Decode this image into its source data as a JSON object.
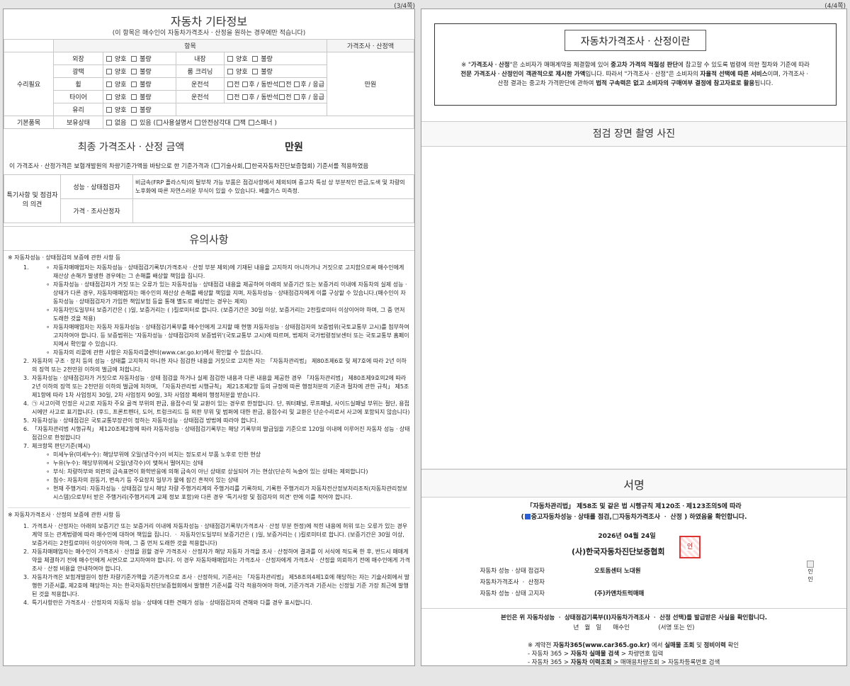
{
  "page_left": {
    "num": "(3/4쪽)"
  },
  "page_right": {
    "num": "(4/4쪽)"
  },
  "misc": {
    "title": "자동차 기타정보",
    "subtitle": "(이 항목은 매수인이 자동차가격조사ㆍ산정을 원하는 경우에만 적습니다)",
    "col_item": "항목",
    "col_price": "가격조사ㆍ산정액",
    "repair_label": "수리필요",
    "basic_label": "기본품목",
    "unit": "만원",
    "good": "양호",
    "bad": "불량",
    "rows": [
      {
        "a": "외장",
        "b": "내장"
      },
      {
        "a": "광택",
        "b": "룸 크리닝"
      },
      {
        "a": "휠",
        "b": "운전석"
      },
      {
        "a": "타이어",
        "b": "운전석"
      },
      {
        "a": "유리",
        "b": ""
      }
    ],
    "front": "전",
    "rear": "후",
    "passenger": "/ 동반석",
    "emergency": "/ 응급",
    "possess_label": "보유상태",
    "none": "없음",
    "yes": "있음 (",
    "manual": "사용설명서",
    "triangle": "안전삼각대",
    "jack": "잭",
    "spanner": "스패너 )"
  },
  "final": {
    "label": "최종 가격조사ㆍ산정 금액",
    "amount": "만원",
    "note_pre": "이 가격조사ㆍ산정가격은 보험개발원의 차량기준가액을 바탕으로 한 기준가격과 (",
    "opt1": "기술사회,",
    "opt2": "한국자동차진단보증협회) 기준서를 적용하였음"
  },
  "special": {
    "label": "특기사항 및 점검자의 의견",
    "r1": "성능ㆍ상태점검자",
    "r1_text": "비금속(FRP 플라스틱)의 탈부착 가능 부품은 점검사항에서 제외되며 중고차 특성 상 부분적인 판금,도색 및 차량의 노후화에 따른 자연스러운 부식이 있을 수 있습니다. 배출가스 미측정.",
    "r2": "가격ㆍ조사산정자"
  },
  "notice": {
    "title": "유의사항",
    "h1": "※ 자동차성능ㆍ상태점검의 보증에 관한 사항 등",
    "item1_no": "1.",
    "sub": [
      "자동차매매업자는 자동차성능ㆍ상태점검기록부(가격조사ㆍ산정 부분 제외)에 기재된 내용을 고지하지 아니하거나 거짓으로 고지함으로써 매수인에게 재산상 손해가 발생한 경우에는 그 손해를 배상할 책임을 집니다.",
      "자동차성능ㆍ상태점검자가 거짓 또는 오류가 있는 자동차성능ㆍ상태점검 내용을 제공하여 아래의 보증기간 또는 보증거리 이내에 자동차의 실제 성능ㆍ상태가 다른 경우, 자동차매매업자는 매수인의 재산상 손해를 배상할 책임을 지며, 자동차성능ㆍ상태점검자에게 이를 구상할 수 있습니다.(매수인이 자동차성능ㆍ상태점검자가 가입한 책임보험 등을 통해 별도로 배상받는 경우는 제외)",
      "자동차인도일부터 보증기간은 ( )일, 보증거리는 ( )킬로미터로 합니다. (보증기간은 30일 이상, 보증거리는 2천킬로미터 이상이어야 하며, 그 중 먼저 도래한 것을 적용)",
      "자동차매매업자는 자동차 자동차성능ㆍ상태점검기록부를 매수인에게 고지할 때 현행 자동차성능ㆍ상태점검자의 보증범위(국토교통부 고시)를 첨부하여 고지하여야 합니다. 등 보증범위는 '자동차성능ㆍ상태점검자의 보증범위'(국토교통부 고시)에 따르며, 법제처 국가법령정보센터 또는 국토교통부 홈페이지에서 확인할 수 있습니다.",
      "자동차의 리콜에 관한 사항은 자동차리콜센터(www.car.go.kr)에서 확인할 수 있습니다."
    ],
    "items": [
      {
        "n": "2.",
        "t": "자동차의 구조ㆍ장치 등의 성능ㆍ상태를 고지하지 아니한 자나 점검한 내용을 거짓으로 고지한 자는 「자동차관리법」 제80조제6호 및 제7호에 따라 2년 이하의 징역 또는 2천만원 이하의 벌금에 처합니다."
      },
      {
        "n": "3.",
        "t": "자동차성능ㆍ상태점검자가 거짓으로 자동차성능ㆍ상태 점검을 하거나 실제 점검한 내용과 다른 내용을 제공한 경우 「자동차관리법」 제80조제9호의2에 따라 2년 이하의 징역 또는 2천만원 이하의 벌금에 처하며, 「자동차관리법 시행규칙」 제21조제2항 등의 규정에 따른 행정처분의 기준과 절차에 관한 규칙」 제5조제1항에 따라 1차 사업정지 30일, 2차 사업정지 90일, 3차 사업장 폐쇄의 행정처분을 받습니다."
      },
      {
        "n": "4.",
        "t": "㉠ 사고이력 인정은 사고로 자동차 주요 골격 부위의 판금, 용접수리 및 교환이 있는 경우로 한정합니다. 단, 쿼터패널, 루프패널, 사이드실패널 부위는 절단, 용접 시에만 사고로 표기합니다. (후드, 프론트펜더, 도어, 트렁크리드 등 외판 부위 및 범퍼에 대한 판금, 용접수리 및 교환은 단순수리로서 사고에 포함되지 않습니다)"
      },
      {
        "n": "5.",
        "t": "자동차성능ㆍ상태점검은 국토교통부장관이 정하는 자동차성능ㆍ상태점검 방법에 따라야 합니다."
      },
      {
        "n": "6.",
        "t": "「자동차관리법 시행규칙」 제120조제2항에 따라 자동차성능ㆍ상태점검기록부는 해당 기록부의 발급일을 기준으로 120일 이내에 이루어진 자동차 성능ㆍ상태점검으로 한정합니다"
      },
      {
        "n": "7.",
        "t": "체크항목 판단기준(예시)"
      }
    ],
    "sub7": [
      "미세누유(미세누수): 해당부위에 오일(냉각수)이 비치는 정도로서 부품 노후로 인한 현상",
      "누유(누수): 해당부위에서 오일(냉각수)이 맺혀서 떨어지는 상태",
      "부식: 차량하부와 외판의 금속표면이 화학반응에 의해 금속이 아닌 상태로 상실되어 가는 현상(단순히 녹슬어 있는 상태는 제외합니다)",
      "침수: 자동차의 원동기, 변속기 등 주요장치 일부가 물에 잠긴 흔적이 있는 상태",
      "현재 주행거리: 자동차성능ㆍ상태점검 당시 해당 차량 주행거리계의 주행거리를 기록하되, 기록한 주행거리가 자동차전산정보처리조직(자동차관리정보시스템)으로부터 받은 주행거리(주행거리계 교체 정보 포함)와 다른 경우 '특기사항 및 점검자의 의견' 란에 이를 적어야 합니다."
    ],
    "h2": "※ 자동차가격조사ㆍ산정의 보증에 관한 사항 등",
    "items2": [
      {
        "n": "1.",
        "t": "가격조사ㆍ산정자는 아래의 보증기간 또는 보증거리 이내에 자동차성능ㆍ상태점검기록부(가격조사ㆍ산정 부분 한정)에 적힌 내용에 허위 또는 오류가 있는 경우 계약 또는 관계법령에 따라 매수인에 대하여 책임을 집니다. ㆍ 자동차인도일부터 보증기간은 ( )일, 보증거리는 ( )킬로미터로 합니다. (보증기간은 30일 이상, 보증거리는 2천킬로미터 이상이어야 하며, 그 중 먼저 도래한 것을 적용합니다)"
      },
      {
        "n": "2.",
        "t": "자동차매매업자는 매수인이 가격조사ㆍ산정을 원할 경우 가격조사ㆍ산정자가 해당 자동차 가격을 조사ㆍ산정하여 결과를 이 서식에 적도록 한 후, 반드시 매매계약을 체결하기 전에 매수인에게 서면으로 고지하여야 합니다. 이 경우 자동차매매업자는 가격조사ㆍ산정자에게 가격조사ㆍ산정을 의뢰하기 전에 매수인에게 가격조사ㆍ산정 비용을 안내하여야 합니다."
      },
      {
        "n": "3.",
        "t": "자동차가격은 보험개발원이 정한 차량기준가액을 기준가격으로 조사ㆍ산정하되, 기준서는 「자동차관리법」 제58조의4제1호에 해당하는 자는 기술사회에서 발행한 기준서를, 제2호에 해당하는 자는 한국자동차진단보증협회에서 발행한 기준서를 각각 적용하여야 하며, 기준가격과 기준서는 신정일 기준 가장 최근에 발행된 것을 적용합니다."
      },
      {
        "n": "4.",
        "t": "특기사항란은 가격조사ㆍ산정자의 자동차 성능ㆍ상태에 대한 견해가 성능ㆍ상태점검자의 견해와 다를 경우 표시합니다."
      }
    ]
  },
  "right": {
    "def_title": "자동차가격조사ㆍ산정이란",
    "def_a": "※ \"",
    "def_b": "가격조사ㆍ산정",
    "def_c": "\"은 소비자가 매매계약을 체결함에 있어 ",
    "def_d": "중고차 가격의 적절성 판단",
    "def_e": "에 참고할 수 있도록 법령에 의한 절차와 기준에 따라 ",
    "def_f": "전문 가격조사ㆍ산정인이 객관적으로 제시한 가액",
    "def_g": "입니다. 따라서 \"가격조사ㆍ산정\"은 소비자의 ",
    "def_h": "자율적 선택에 따른 서비스",
    "def_i": "이며, 가격조사ㆍ산정 결과는 중고차 가격판단에 관하여 ",
    "def_j": "법적 구속력은 없고 소비자의 구매여부 결정에 참고자료로 활용",
    "def_k": "됩니다.",
    "photo_title": "점검 장면 촬영 사진",
    "sign_title": "서명",
    "law": "「자동차관리법」 제58조 및 같은 법 시행규칙 제120조ㆍ제123조의5에 따라",
    "confirm_pre": "(",
    "confirm_opt1": "중고자동차성능ㆍ상태를 점검,",
    "confirm_opt2": "자동차가격조사 ㆍ 산정 ) 하였음을 확인합니다.",
    "date": "2026년 04월 24일",
    "org": "(사)한국자동차진단보증협회",
    "seal": "인",
    "roles": [
      {
        "role": "자동차 성능ㆍ상태 점검자",
        "name": "오토돔센터 노대원"
      },
      {
        "role": "자동차가격조사 ㆍ 산정자",
        "name": ""
      },
      {
        "role": "자동차 성능ㆍ상태 고지자",
        "name": "(주)카앤차트럭매매"
      }
    ],
    "img_alt": "인\n인",
    "buyer_line": "본인은 위 자동차성능 ㆍ 상태점검기록부(Ⅰ)자동차가격조사 ㆍ 산정 선택)를 발급받은 사실을 확인합니다.",
    "buyer_sig": "년   월   일      매수인               (서명 또는 인)",
    "ref1_pre": "※ 계약전 ",
    "ref1_a": "자동차365(www.car365.go.kr)",
    "ref1_b": " 에서 ",
    "ref1_c": "실매물 조회",
    "ref1_d": " 및 ",
    "ref1_e": "정비이력",
    "ref1_f": " 확인",
    "ref2_pre": "- 자동차 365 > ",
    "ref2_b": "자동차 실매물 검색",
    "ref2_c": " > 차량번호 입력",
    "ref3_pre": "- 자동차 365 > ",
    "ref3_b": "자동차 이력조회",
    "ref3_c": " > 매매용차량조회 > 자동차등록번호 검색"
  }
}
